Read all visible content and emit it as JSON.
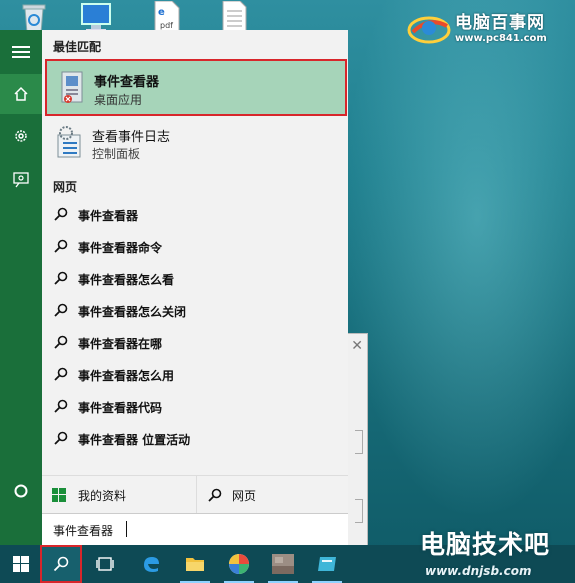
{
  "desktop": {
    "watermark_top": {
      "title": "电脑百事网",
      "url": "www.pc841.com"
    },
    "watermark_bottom": {
      "title": "电脑技术吧",
      "url": "www.dnjsb.com"
    },
    "icons": [
      "recycle-bin-icon",
      "computer-icon",
      "pdf-file-icon",
      "text-file-icon"
    ]
  },
  "rail": {
    "items": [
      "hamburger-icon",
      "home-icon",
      "settings-gear-icon",
      "user-feedback-icon",
      "cortana-circle-icon"
    ]
  },
  "panel": {
    "best_match_label": "最佳匹配",
    "best_match": {
      "title": "事件查看器",
      "subtitle": "桌面应用"
    },
    "second": {
      "title": "查看事件日志",
      "subtitle": "控制面板"
    },
    "web_label": "网页",
    "web_results": [
      "事件查看器",
      "事件查看器命令",
      "事件查看器怎么看",
      "事件查看器怎么关闭",
      "事件查看器在哪",
      "事件查看器怎么用",
      "事件查看器代码",
      "事件查看器 位置活动"
    ],
    "bottom": {
      "my_stuff": "我的资料",
      "web": "网页"
    },
    "search_value": "事件查看器"
  },
  "colors": {
    "accent_green": "#1a6f3a",
    "highlight": "#a6d4b9",
    "annotation_red": "#d8262b",
    "taskbar": "#0e4a55"
  }
}
